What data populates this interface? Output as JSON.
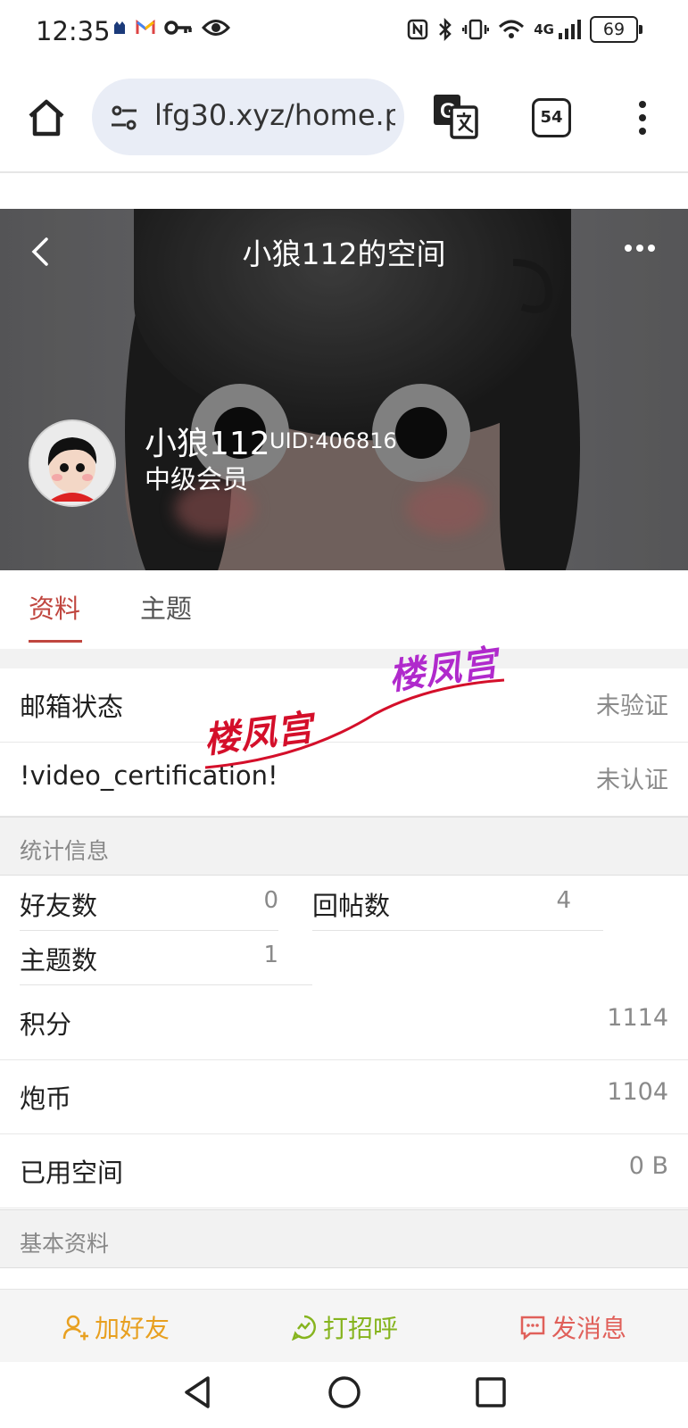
{
  "status_bar": {
    "time": "12:35",
    "network": "4G",
    "battery": "69",
    "left_icons": [
      "app-icon",
      "gmail-icon",
      "key-icon",
      "eye-icon"
    ],
    "right_icons": [
      "nfc-icon",
      "bluetooth-icon",
      "vibrate-icon",
      "wifi-icon",
      "signal-icon",
      "battery-icon"
    ]
  },
  "browser": {
    "url": "lfg30.xyz/home.p",
    "tab_count": "54"
  },
  "profile_header": {
    "title": "小狼112的空间",
    "username": "小狼112",
    "uid": "UID:406816",
    "level": "中级会员"
  },
  "tabs": [
    {
      "label": "资料",
      "active": true
    },
    {
      "label": "主题",
      "active": false
    }
  ],
  "info_rows": [
    {
      "label": "邮箱状态",
      "value": "未验证"
    },
    {
      "label": "!video_certification!",
      "value": "未认证"
    }
  ],
  "stats_section": {
    "title": "统计信息",
    "grid": [
      {
        "label": "好友数",
        "value": "0"
      },
      {
        "label": "回帖数",
        "value": "4"
      },
      {
        "label": "主题数",
        "value": "1"
      }
    ],
    "rows": [
      {
        "label": "积分",
        "value": "1114"
      },
      {
        "label": "炮币",
        "value": "1104"
      },
      {
        "label": "已用空间",
        "value": "0 B"
      }
    ]
  },
  "basic_section": {
    "title": "基本资料"
  },
  "watermark": {
    "text1": "楼凤宫",
    "text2": "楼凤宫"
  },
  "actions": {
    "add_friend": "加好友",
    "greet": "打招呼",
    "message": "发消息"
  },
  "colors": {
    "accent": "#c0463f",
    "add_friend": "#e8a020",
    "greet": "#86b41e",
    "message": "#e0605a"
  }
}
